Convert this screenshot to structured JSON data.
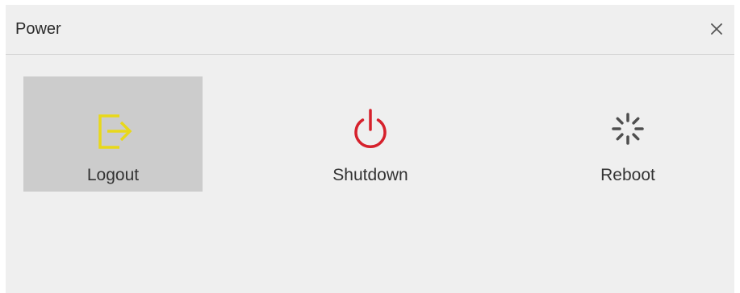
{
  "dialog": {
    "title": "Power",
    "close_icon": "close-icon"
  },
  "actions": [
    {
      "label": "Logout",
      "icon": "logout-icon",
      "selected": true,
      "color": "#e8d81a"
    },
    {
      "label": "Shutdown",
      "icon": "power-icon",
      "selected": false,
      "color": "#d6212c"
    },
    {
      "label": "Reboot",
      "icon": "reboot-spinner-icon",
      "selected": false,
      "color": "#4e4e4e"
    }
  ],
  "colors": {
    "dialog_background": "#efefef",
    "selected_tile": "#cccccc"
  }
}
